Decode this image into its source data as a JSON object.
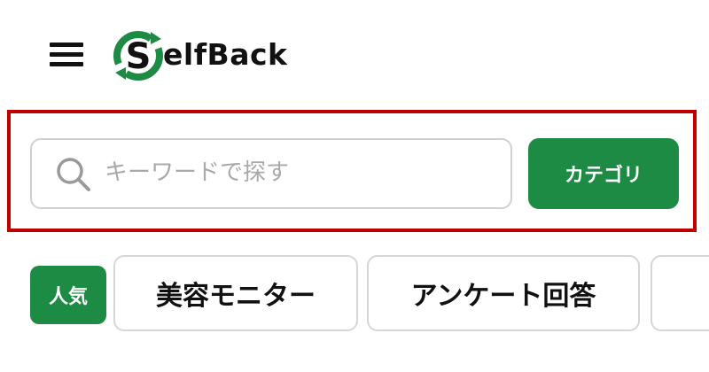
{
  "header": {
    "menu_icon": "hamburger-menu-icon",
    "logo": {
      "text": "SelfBack",
      "letter_mark": "S",
      "text_after_mark": "elfBack",
      "colors": {
        "ring": "#1e8b45",
        "letter": "#111111",
        "text": "#111111"
      }
    }
  },
  "search": {
    "icon": "search-icon",
    "placeholder": "キーワードで探す",
    "value": "",
    "category_button_label": "カテゴリ"
  },
  "tags": {
    "popular_label": "人気",
    "items": [
      {
        "label": "美容モニター"
      },
      {
        "label": "アンケート回答"
      },
      {
        "label": ""
      }
    ]
  },
  "colors": {
    "accent": "#1e8b45",
    "highlight": "#c00000",
    "border": "#d0d0d0",
    "placeholder": "#a9a9a9"
  }
}
